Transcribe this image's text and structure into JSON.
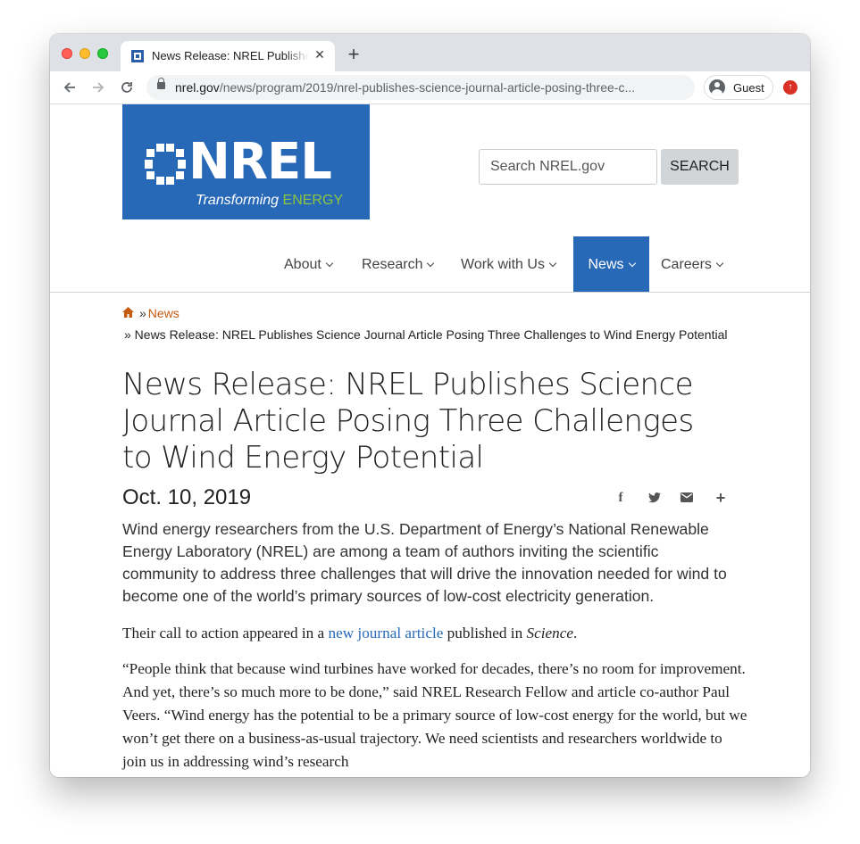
{
  "browser": {
    "tab_title": "News Release: NREL Publishes Science Journal Article Posing Three Challenges to Wind Energy Potential",
    "tab_close": "✕",
    "new_tab": "+",
    "url_domain": "nrel.gov",
    "url_path": "/news/program/2019/nrel-publishes-science-journal-article-posing-three-c...",
    "profile_label": "Guest",
    "icons": [
      "back-arrow-icon",
      "forward-arrow-icon",
      "reload-icon",
      "lock-icon",
      "avatar-icon",
      "update-icon"
    ]
  },
  "site": {
    "logo_word": "NREL",
    "logo_tag_prefix": "Transforming ",
    "logo_tag_accent": "ENERGY",
    "brand_color": "#2869b7",
    "accent_green": "#8cc63f",
    "search_placeholder": "Search NREL.gov",
    "search_button": "SEARCH",
    "nav": [
      {
        "label": "About",
        "active": false
      },
      {
        "label": "Research",
        "active": false
      },
      {
        "label": "Work with Us",
        "active": false
      },
      {
        "label": "News",
        "active": true
      },
      {
        "label": "Careers",
        "active": false
      }
    ]
  },
  "breadcrumb": {
    "separator": "»",
    "news": "News",
    "current": "» News Release: NREL Publishes Science Journal Article Posing Three Challenges to Wind Energy Potential"
  },
  "article": {
    "title": "News Release: NREL Publishes Science Journal Article Posing Three Challenges to Wind Energy Potential",
    "date": "Oct. 10, 2019",
    "share_icons": [
      "facebook-icon",
      "twitter-icon",
      "email-icon",
      "plus-icon"
    ],
    "lead": "Wind energy researchers from the U.S. Department of Energy’s National Renewable Energy Laboratory (NREL) are among a team of authors inviting the scientific community to address three challenges that will drive the innovation needed for wind to become one of the world’s primary sources of low-cost electricity generation.",
    "p1_before": "Their call to action appeared in a ",
    "p1_link": "new journal article",
    "p1_middle": " published in ",
    "p1_em": "Science",
    "p1_after": ".",
    "p2": "“People think that because wind turbines have worked for decades, there’s no room for improvement. And yet, there’s so much more to be done,” said NREL Research Fellow and article co-author Paul Veers. “Wind energy has the potential to be a primary source of low-cost energy for the world, but we won’t get there on a business-as-usual trajectory. We need scientists and researchers worldwide to join us in addressing wind’s research"
  }
}
